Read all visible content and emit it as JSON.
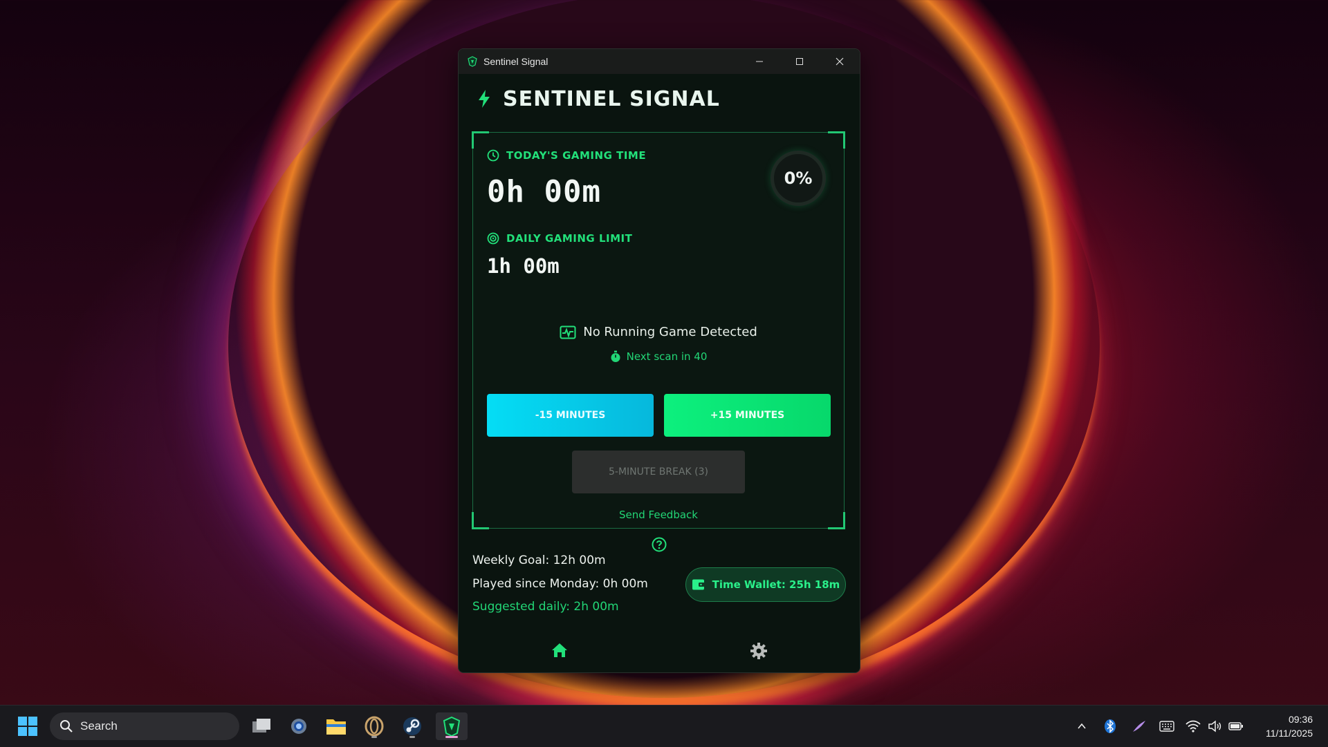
{
  "window": {
    "title": "Sentinel Signal",
    "controls": [
      "minimize",
      "maximize",
      "close"
    ]
  },
  "app": {
    "title": "SENTINEL SIGNAL",
    "accent_color": "#22e07a"
  },
  "today": {
    "label": "TODAY'S GAMING TIME",
    "time": "0h 00m",
    "percent": "0%",
    "percent_value": 0
  },
  "limit": {
    "label": "DAILY GAMING LIMIT",
    "time": "1h 00m"
  },
  "status": {
    "message": "No Running Game Detected",
    "scan": "Next scan in 40"
  },
  "buttons": {
    "minus": "-15 MINUTES",
    "plus": "+15 MINUTES",
    "break": "5-MINUTE BREAK (3)",
    "feedback": "Send Feedback"
  },
  "weekly": {
    "goal": "Weekly Goal: 12h 00m",
    "played": "Played since Monday: 0h 00m",
    "suggested": "Suggested daily: 2h 00m",
    "wallet": "Time Wallet: 25h 18m"
  },
  "nav": {
    "items": [
      "home-icon",
      "settings-icon"
    ],
    "active": "home-icon"
  },
  "taskbar": {
    "search_placeholder": "Search",
    "apps": [
      "start-icon",
      "task-view-icon",
      "settings-app-icon",
      "file-explorer-icon",
      "opera-icon",
      "steam-icon",
      "sentinel-signal-icon"
    ],
    "time": "09:36",
    "date": "11/11/2025"
  }
}
